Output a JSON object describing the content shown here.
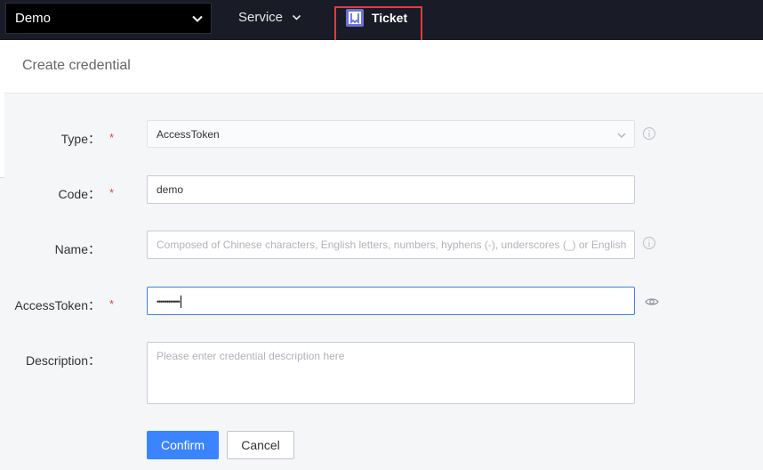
{
  "topbar": {
    "project": "Demo",
    "service_label": "Service",
    "ticket_label": "Ticket"
  },
  "panel": {
    "title": "Create credential"
  },
  "form": {
    "type": {
      "label": "Type：",
      "value": "AccessToken"
    },
    "code": {
      "label": "Code：",
      "value": "demo"
    },
    "name": {
      "label": "Name：",
      "placeholder": "Composed of Chinese characters, English letters, numbers, hyphens (-), underscores (_) or English"
    },
    "access_token": {
      "label": "AccessToken：",
      "value": "••••••••••••"
    },
    "description": {
      "label": "Description：",
      "placeholder": "Please enter credential description here"
    },
    "required_mark": "*"
  },
  "buttons": {
    "confirm": "Confirm",
    "cancel": "Cancel"
  },
  "colors": {
    "primary": "#3a84ff",
    "topbar": "#191b26",
    "highlight": "#e03c3c",
    "required": "#e54545"
  }
}
